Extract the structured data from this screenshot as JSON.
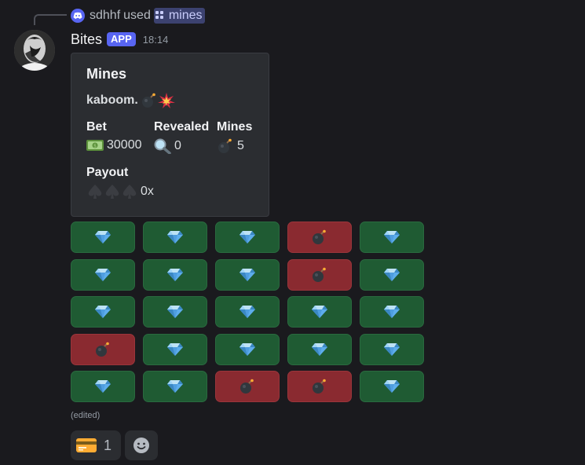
{
  "command_use": {
    "user": "sdhhf",
    "used_word": "used",
    "command": "mines"
  },
  "message": {
    "bot_name": "Bites",
    "badge": "APP",
    "timestamp": "18:14",
    "edited": "(edited)"
  },
  "embed": {
    "title": "Mines",
    "description": "kaboom.",
    "fields": {
      "bet": {
        "name": "Bet",
        "value": "30000",
        "icon": "money-icon"
      },
      "revealed": {
        "name": "Revealed",
        "value": "0",
        "icon": "magnifier-icon"
      },
      "mines": {
        "name": "Mines",
        "value": "5",
        "icon": "bomb-icon"
      },
      "payout": {
        "name": "Payout",
        "value": "0x",
        "icon": "spade-icon"
      }
    }
  },
  "board": [
    [
      "gem",
      "gem",
      "gem",
      "bomb",
      "gem"
    ],
    [
      "gem",
      "gem",
      "gem",
      "bomb",
      "gem"
    ],
    [
      "gem",
      "gem",
      "gem",
      "gem",
      "gem"
    ],
    [
      "bomb",
      "gem",
      "gem",
      "gem",
      "gem"
    ],
    [
      "gem",
      "gem",
      "bomb",
      "bomb",
      "gem"
    ]
  ],
  "reactions": [
    {
      "icon": "credit-card-icon",
      "count": "1"
    }
  ],
  "colors": {
    "background": "#1a1a1e",
    "embed": "#2b2d31",
    "gem_tile": "#1f5b33",
    "bomb_tile": "#8a2a30",
    "accent": "#5865f2"
  }
}
